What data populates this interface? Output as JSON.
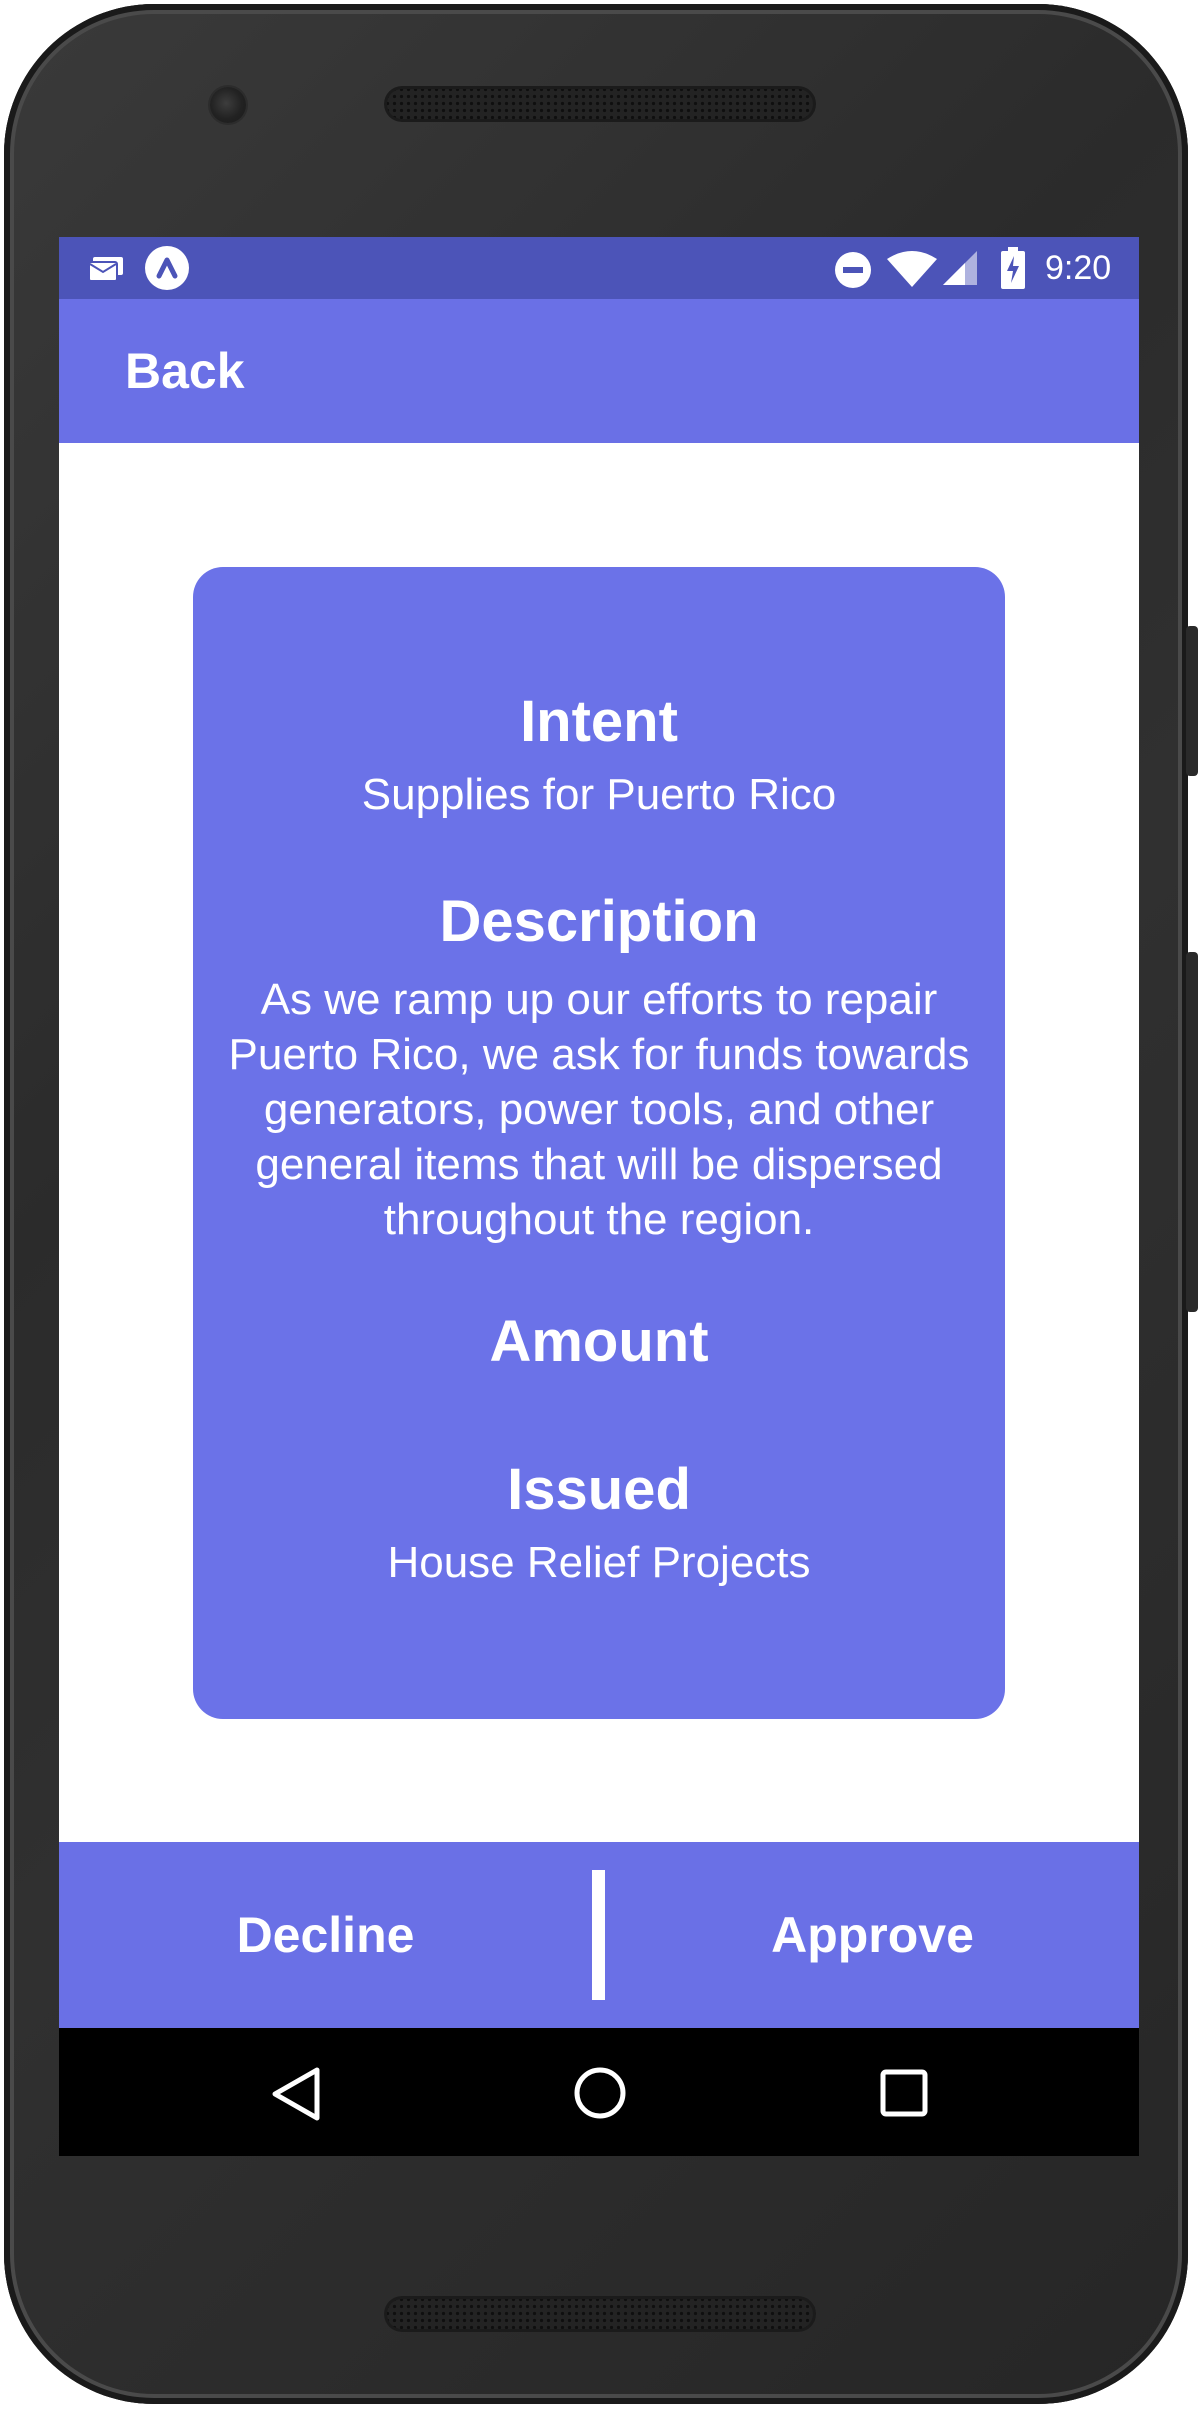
{
  "status_bar": {
    "time": "9:20",
    "icons": [
      "message-notification-icon",
      "app-a-icon",
      "do-not-disturb-icon",
      "wifi-icon",
      "cellular-icon",
      "battery-charging-icon"
    ]
  },
  "app_bar": {
    "back_label": "Back"
  },
  "card": {
    "intent_label": "Intent",
    "intent_value": "Supplies for Puerto Rico",
    "description_label": "Description",
    "description_value": "As we ramp up our efforts to repair Puerto Rico, we ask for funds towards generators, power tools, and other general items that will be dispersed throughout the region.",
    "amount_label": "Amount",
    "amount_value": "",
    "issued_label": "Issued",
    "issued_value": "House Relief Projects"
  },
  "actions": {
    "decline_label": "Decline",
    "approve_label": "Approve"
  },
  "navigation": {
    "icons": [
      "back-triangle-icon",
      "home-circle-icon",
      "recents-square-icon"
    ]
  },
  "colors": {
    "primary": "#6a70e6",
    "card": "#6b72e8",
    "status_bar": "#4c54b8",
    "text": "#ffffff"
  }
}
